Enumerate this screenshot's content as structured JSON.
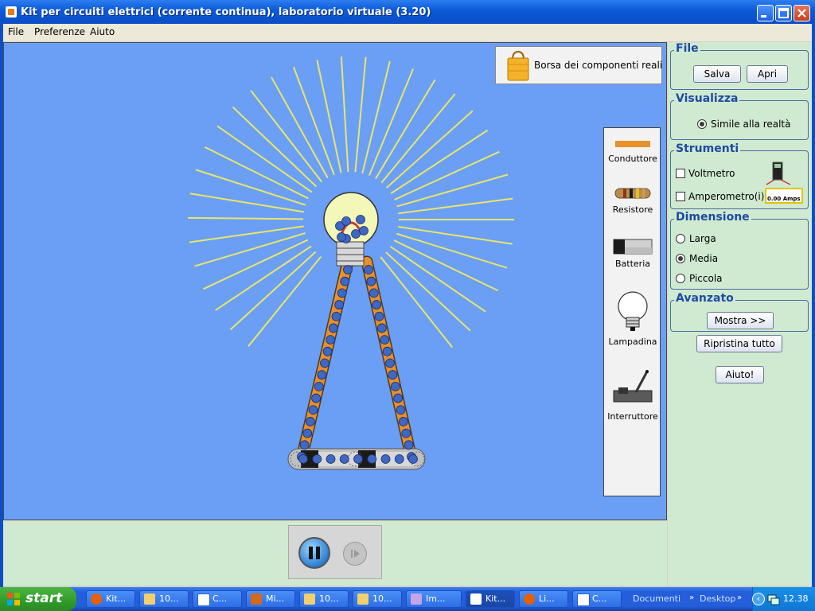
{
  "window": {
    "title": "Kit per circuiti elettrici (corrente continua), laboratorio virtuale (3.20)"
  },
  "menu": {
    "file": "File",
    "preferences": "Preferenze",
    "help": "Aiuto"
  },
  "canvas": {
    "bag_label": "Borsa dei componenti reali",
    "toolbox": [
      "Conduttore",
      "Resistore",
      "Batteria",
      "Lampadina",
      "Interruttore"
    ]
  },
  "controls": {
    "file": {
      "title": "File",
      "save": "Salva",
      "open": "Apri"
    },
    "view": {
      "title": "Visualizza",
      "option": "Simile alla realtà",
      "selected": true
    },
    "tools": {
      "title": "Strumenti",
      "voltmeter": "Voltmetro",
      "ammeter": "Amperometro(i)",
      "ammeter_reading": "0.00 Amps",
      "voltmeter_checked": false,
      "ammeter_checked": false
    },
    "size": {
      "title": "Dimensione",
      "options": [
        "Larga",
        "Media",
        "Piccola"
      ],
      "selected": "Media"
    },
    "advanced": {
      "title": "Avanzato",
      "show": "Mostra >>"
    },
    "reset": "Ripristina tutto",
    "help": "Aiuto!"
  },
  "taskbar": {
    "start": "start",
    "tasks": [
      "Kit...",
      "10...",
      "C...",
      "Mi...",
      "10...",
      "10...",
      "Im...",
      "Kit...",
      "Li...",
      "C..."
    ],
    "active_index": 7,
    "links": [
      "Documenti",
      "Desktop"
    ],
    "clock": "12.38"
  },
  "colors": {
    "canvas_bg": "#6b9ff6",
    "panel_bg": "#cfead0",
    "wire": "#e8902c",
    "ray": "#e8e66a",
    "electron": "#3f67c4"
  }
}
